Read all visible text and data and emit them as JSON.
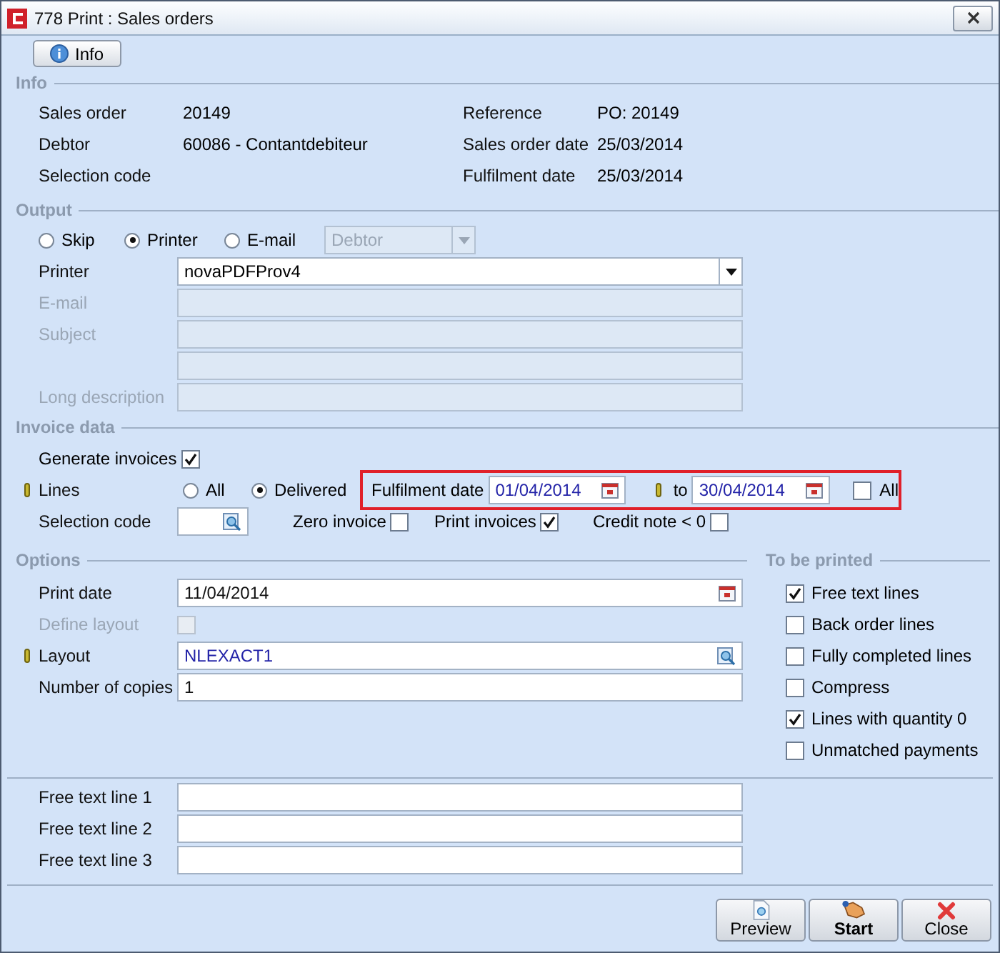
{
  "window": {
    "title": "778 Print : Sales orders"
  },
  "info_button": {
    "label": "Info"
  },
  "info": {
    "header": "Info",
    "left": [
      {
        "label": "Sales order",
        "value": "20149"
      },
      {
        "label": "Debtor",
        "value": "60086 - Contantdebiteur"
      },
      {
        "label": "Selection code"
      }
    ],
    "right": [
      {
        "label": "Reference",
        "value": "PO: 20149"
      },
      {
        "label": "Sales order date",
        "value": "25/03/2014"
      },
      {
        "label": "Fulfilment date",
        "value": "25/03/2014"
      }
    ]
  },
  "output": {
    "header": "Output",
    "modes": [
      {
        "label": "Skip",
        "selected": false
      },
      {
        "label": "Printer",
        "selected": true
      },
      {
        "label": "E-mail",
        "selected": false
      }
    ],
    "recipient": {
      "value": "Debtor",
      "disabled": true
    },
    "fields": [
      {
        "label": "Printer",
        "value": "novaPDFProv4",
        "kind": "dropdown",
        "disabled": false
      },
      {
        "label": "E-mail",
        "kind": "text",
        "disabled": true
      },
      {
        "label": "Subject",
        "kind": "text",
        "disabled": true
      },
      {
        "kind": "text",
        "disabled": true
      },
      {
        "label": "Long description",
        "kind": "text",
        "disabled": true
      }
    ]
  },
  "invoice_data": {
    "header": "Invoice data",
    "generate": {
      "label": "Generate invoices",
      "checked": true
    },
    "lines": {
      "label": "Lines",
      "required": true,
      "options": [
        {
          "label": "All",
          "selected": false
        },
        {
          "label": "Delivered",
          "selected": true
        }
      ]
    },
    "fulfilment": {
      "highlighted": true,
      "label": "Fulfilment date",
      "from": "01/04/2014",
      "to_label": "to",
      "to": "30/04/2014",
      "all": {
        "label": "All",
        "checked": false
      }
    },
    "selection_code": {
      "label": "Selection code"
    },
    "flags": [
      {
        "label": "Zero invoice",
        "checked": false
      },
      {
        "label": "Print invoices",
        "checked": true
      },
      {
        "label": "Credit note < 0",
        "checked": false
      }
    ]
  },
  "options": {
    "header": "Options",
    "print_date": {
      "label": "Print date",
      "value": "11/04/2014"
    },
    "define_layout": {
      "label": "Define layout",
      "checked": false,
      "disabled": true
    },
    "layout": {
      "label": "Layout",
      "value": "NLEXACT1",
      "required": true
    },
    "copies": {
      "label": "Number of copies",
      "value": "1"
    }
  },
  "to_be_printed": {
    "header": "To be printed",
    "items": [
      {
        "label": "Free text lines",
        "checked": true
      },
      {
        "label": "Back order lines",
        "checked": false
      },
      {
        "label": "Fully completed lines",
        "checked": false
      },
      {
        "label": "Compress",
        "checked": false
      },
      {
        "label": "Lines with quantity 0",
        "checked": true
      },
      {
        "label": "Unmatched payments",
        "checked": false
      }
    ]
  },
  "free_text": [
    {
      "label": "Free text line 1"
    },
    {
      "label": "Free text line 2"
    },
    {
      "label": "Free text line 3"
    }
  ],
  "buttons": [
    {
      "label": "Preview",
      "kind": "preview"
    },
    {
      "label": "Start",
      "kind": "start"
    },
    {
      "label": "Close",
      "kind": "close"
    }
  ]
}
